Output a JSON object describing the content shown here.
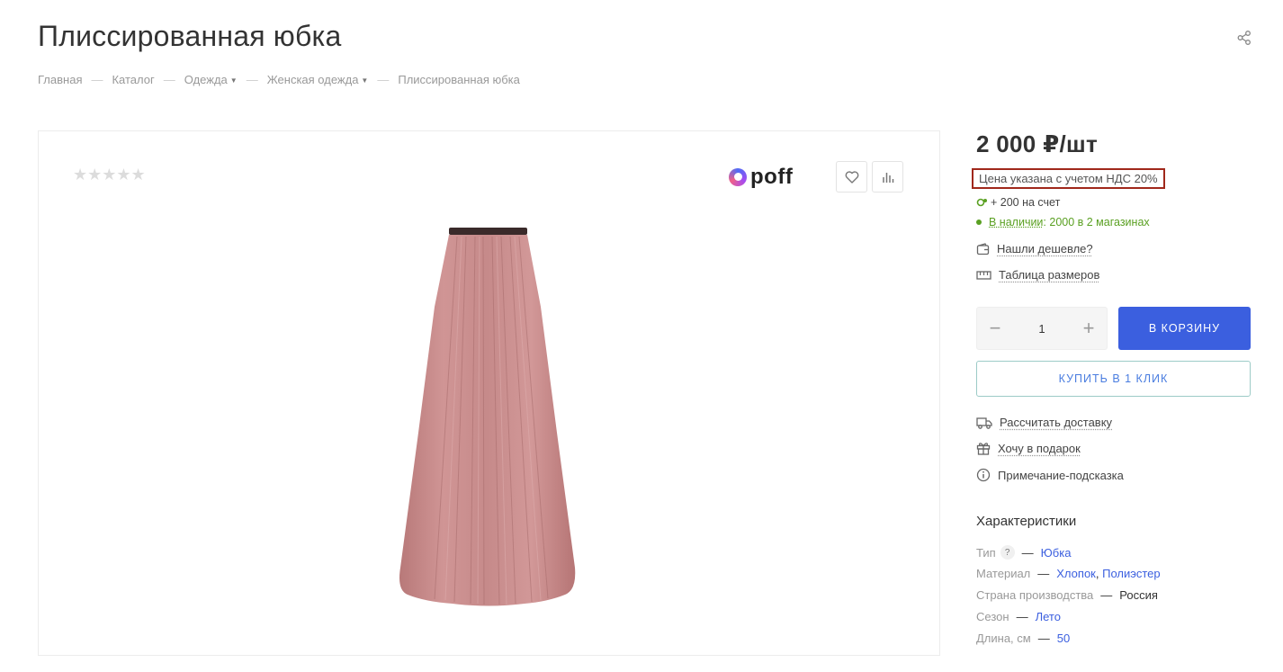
{
  "page": {
    "title": "Плиссированная юбка"
  },
  "breadcrumb": {
    "items": [
      {
        "label": "Главная"
      },
      {
        "label": "Каталог"
      },
      {
        "label": "Одежда"
      },
      {
        "label": "Женская одежда"
      },
      {
        "label": "Плиссированная юбка"
      }
    ],
    "separator": "—"
  },
  "gallery": {
    "stars": "★★★★★",
    "rating": 0,
    "brand": "poff"
  },
  "buy": {
    "price": "2 000 ₽/шт",
    "vat_note": "Цена указана с учетом НДС 20%",
    "bonus": "+ 200 на счет",
    "stock_link": "В наличии",
    "stock_rest": ": 2000 в 2 магазинах",
    "cheaper": "Нашли дешевле?",
    "sizes": "Таблица размеров",
    "quantity": "1",
    "qty_minus": "−",
    "qty_plus": "+",
    "cart_label": "В КОРЗИНУ",
    "oneclick_label": "КУПИТЬ В 1 КЛИК",
    "delivery": "Рассчитать доставку",
    "gift": "Хочу в подарок",
    "hint": "Примечание-подсказка"
  },
  "props": {
    "title": "Характеристики",
    "dash": "—",
    "qmark": "?",
    "items": [
      {
        "name": "Тип",
        "value": "Юбка"
      },
      {
        "name": "Материал",
        "value": "Хлопок",
        "value2": "Полиэстер"
      },
      {
        "name": "Страна производства",
        "value": "Россия"
      },
      {
        "name": "Сезон",
        "value": "Лето"
      },
      {
        "name": "Длина, см",
        "value": "50"
      }
    ]
  },
  "colors": {
    "accent": "#3b5fdf",
    "stock_green": "#5aa022",
    "highlight_border": "#a0281b",
    "skirt": "#c98a8b"
  }
}
